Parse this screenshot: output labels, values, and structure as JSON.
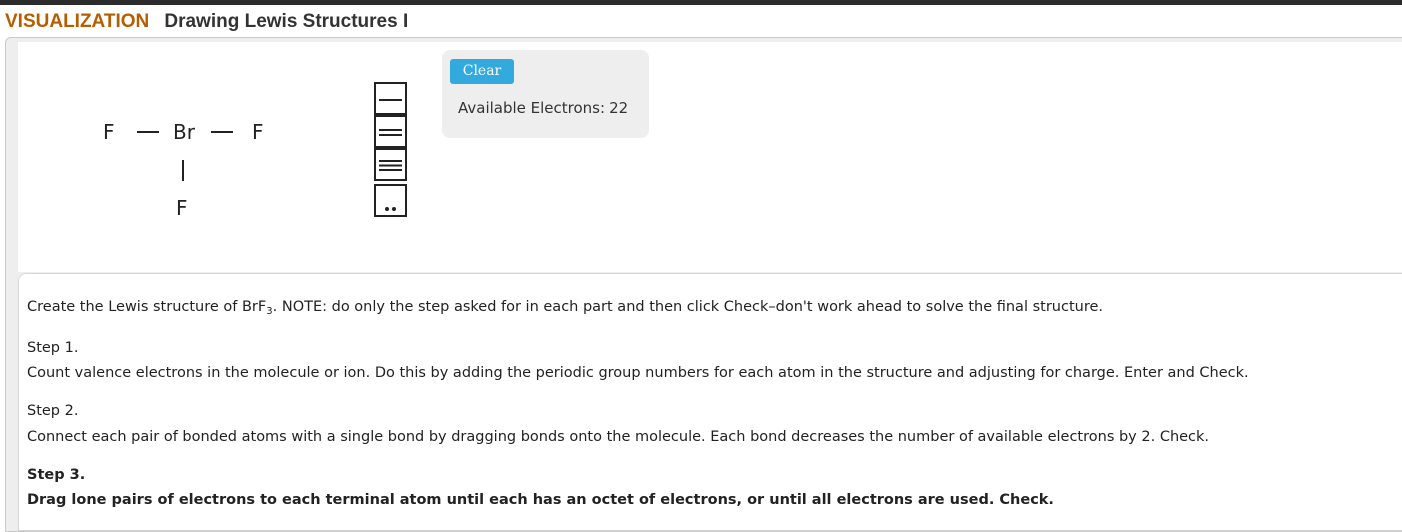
{
  "header": {
    "kicker": "VISUALIZATION",
    "title": "Drawing Lewis Structures I"
  },
  "molecule": {
    "atoms": {
      "left_f": "F",
      "center_br": "Br",
      "right_f": "F",
      "bottom_f": "F"
    }
  },
  "palette": {
    "items": [
      "single-bond",
      "double-bond",
      "triple-bond",
      "lone-pair"
    ]
  },
  "controls": {
    "clear_label": "Clear",
    "available_label": "Available Electrons:",
    "available_value": "22"
  },
  "instructions": {
    "intro_before": "Create the Lewis structure of BrF",
    "intro_sub": "3",
    "intro_after": ". NOTE: do only the step asked for in each part and then click Check–don't work ahead to solve the final structure.",
    "steps": [
      {
        "heading": "Step 1.",
        "text": "Count valence electrons in the molecule or ion. Do this by adding the periodic group numbers for each atom in the structure and adjusting for charge. Enter and Check."
      },
      {
        "heading": "Step 2.",
        "text": "Connect each pair of bonded atoms with a single bond by dragging bonds onto the molecule. Each bond decreases the number of available electrons by 2. Check."
      },
      {
        "heading": "Step 3.",
        "text": "Drag lone pairs of electrons to each terminal atom until each has an octet of electrons, or until all electrons are used. Check."
      }
    ]
  },
  "colors": {
    "kicker": "#b85c00",
    "title": "#333333",
    "clear_button": "#33aadd",
    "panel_bg": "#eeeeee"
  }
}
